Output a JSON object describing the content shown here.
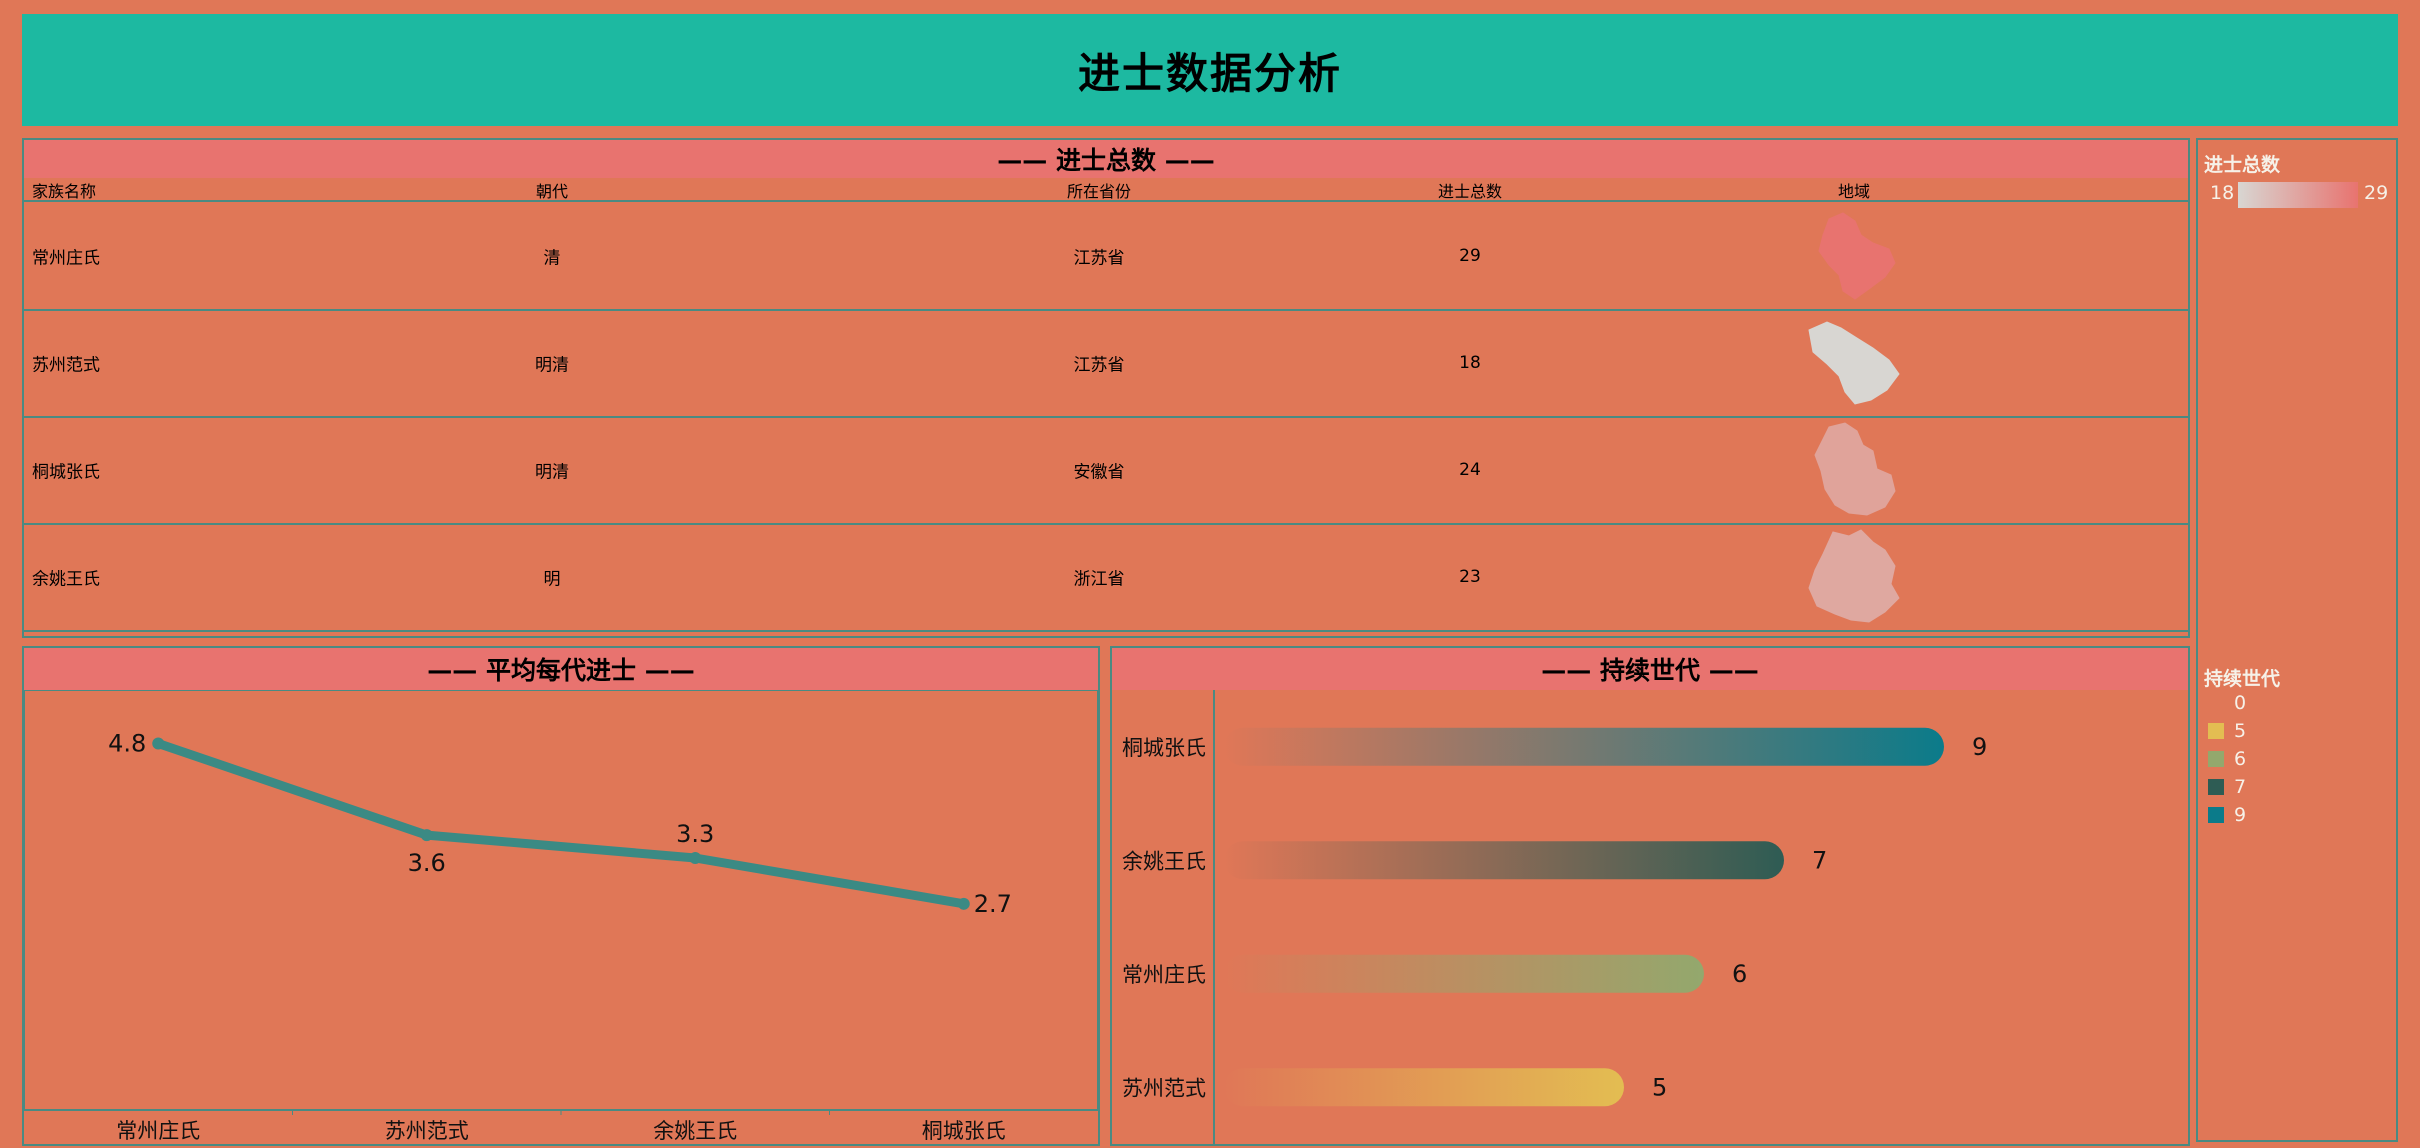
{
  "header": {
    "title": "进士数据分析"
  },
  "table": {
    "title": "—— 进士总数 ——",
    "columns": [
      "家族名称",
      "朝代",
      "所在省份",
      "进士总数",
      "地域"
    ],
    "rows": [
      {
        "family": "常州庄氏",
        "dynasty": "清",
        "province": "江苏省",
        "total": "29",
        "map_color": "#e8736f"
      },
      {
        "family": "苏州范式",
        "dynasty": "明清",
        "province": "江苏省",
        "total": "18",
        "map_color": "#d8d6d2"
      },
      {
        "family": "桐城张氏",
        "dynasty": "明清",
        "province": "安徽省",
        "total": "24",
        "map_color": "#e0a39a"
      },
      {
        "family": "余姚王氏",
        "dynasty": "明",
        "province": "浙江省",
        "total": "23",
        "map_color": "#dfa8a0"
      }
    ]
  },
  "legend": {
    "total_title": "进士总数",
    "total_min": "18",
    "total_max": "29",
    "gen_title": "持续世代",
    "gen_items": [
      {
        "label": "0",
        "color": ""
      },
      {
        "label": "5",
        "color": "#e3bd52"
      },
      {
        "label": "6",
        "color": "#93a86d"
      },
      {
        "label": "7",
        "color": "#2e5c54"
      },
      {
        "label": "9",
        "color": "#0b7b8a"
      }
    ]
  },
  "chart_data": [
    {
      "type": "line",
      "title": "—— 平均每代进士 ——",
      "categories": [
        "常州庄氏",
        "苏州范式",
        "余姚王氏",
        "桐城张氏"
      ],
      "values": [
        4.8,
        3.6,
        3.3,
        2.7
      ],
      "labels": [
        "4.8",
        "3.6",
        "3.3",
        "2.7"
      ],
      "ylim": [
        0,
        5.5
      ],
      "color": "#3b8a84"
    },
    {
      "type": "bar",
      "orientation": "horizontal",
      "title": "—— 持续世代 ——",
      "categories": [
        "桐城张氏",
        "余姚王氏",
        "常州庄氏",
        "苏州范式"
      ],
      "values": [
        9,
        7,
        6,
        5
      ],
      "labels": [
        "9",
        "7",
        "6",
        "5"
      ],
      "xlim": [
        0,
        10
      ],
      "colors": [
        "#0b7b8a",
        "#2e5c54",
        "#93a86d",
        "#e3bd52"
      ]
    }
  ]
}
